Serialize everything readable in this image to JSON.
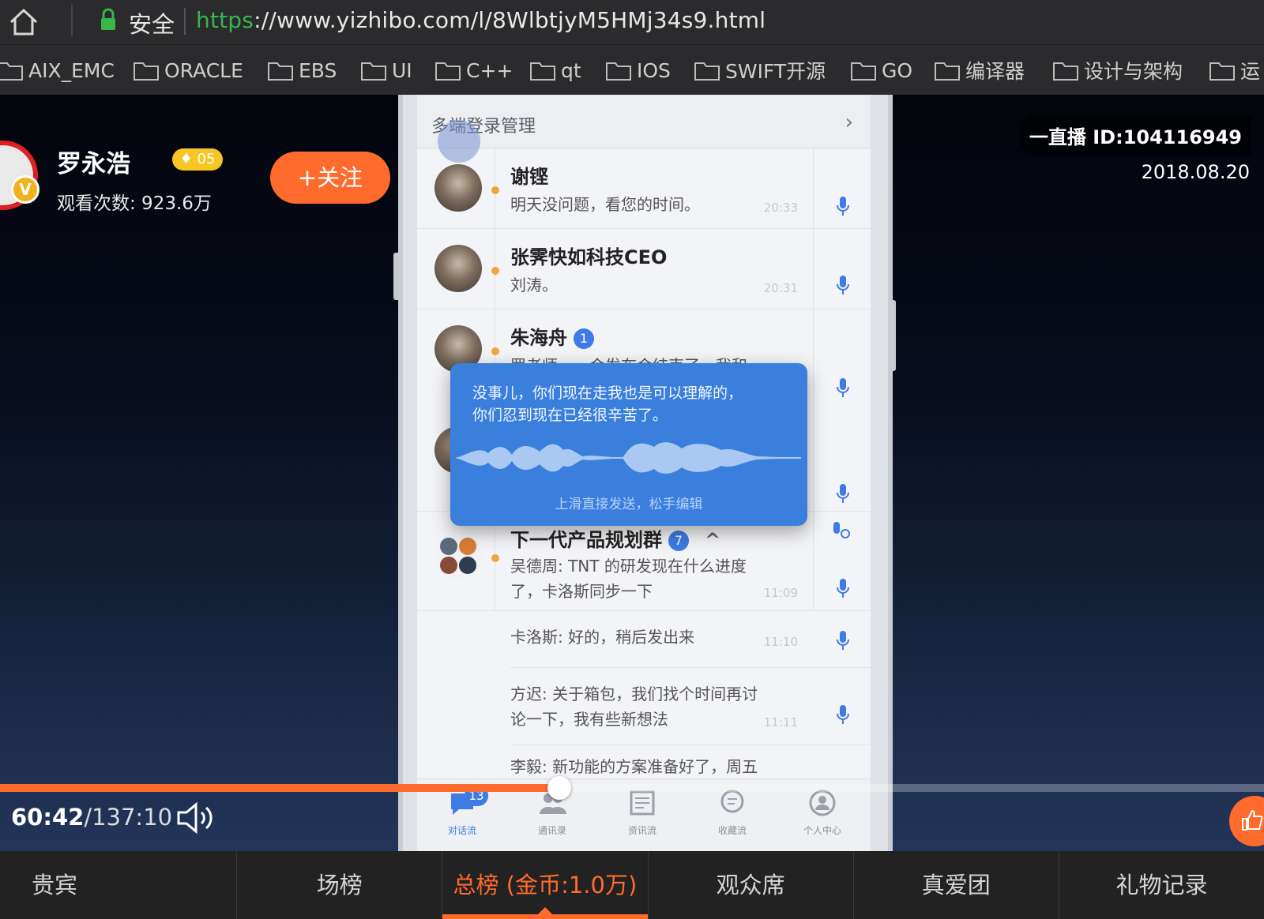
{
  "browser": {
    "secure_label": "安全",
    "url_scheme": "https",
    "url_rest": "://www.yizhibo.com/l/8WlbtjyM5HMj34s9.html",
    "bookmarks": [
      "AIX_EMC",
      "ORACLE",
      "EBS",
      "UI",
      "C++",
      "qt",
      "IOS",
      "SWIFT开源",
      "GO",
      "编译器",
      "设计与架构",
      "运"
    ]
  },
  "host": {
    "name": "罗永浩",
    "level": "05",
    "views": "观看次数: 923.6万",
    "follow_label": "+关注",
    "verified_badge": "V"
  },
  "live": {
    "id": "一直播 ID:104116949",
    "date": "2018.08.20"
  },
  "phone_screen": {
    "header_title": "多端登录管理",
    "chats": [
      {
        "name": "谢铿",
        "message": "明天没问题，看您的时间。",
        "time": "20:33"
      },
      {
        "name": "张霁快如科技CEO",
        "message": "刘涛。",
        "time": "20:31"
      },
      {
        "name": "朱海舟",
        "badge": "1",
        "message": "罗老师，一会发布会结束了，我和"
      },
      {
        "name": "下一代产品规划群",
        "badge": "7",
        "message": "吴德周: TNT 的研发现在什么进度",
        "message2": "了，卡洛斯同步一下",
        "time": "11:09"
      }
    ],
    "sub_messages": [
      {
        "message": "卡洛斯: 好的，稍后发出来",
        "time": "11:10"
      },
      {
        "message": "方迟: 关于箱包，我们找个时间再讨",
        "message2": "论一下，我有些新想法",
        "time": "11:11"
      },
      {
        "message": "李毅: 新功能的方案准备好了，周五"
      }
    ],
    "voice_popup": {
      "text": "没事儿，你们现在走我也是可以理解的，\n你们忍到现在已经很辛苦了。",
      "hint": "上滑直接发送，松手编辑"
    },
    "tabs": [
      {
        "label": "对话流",
        "count": "13"
      },
      {
        "label": "通讯录"
      },
      {
        "label": "资讯流"
      },
      {
        "label": "收藏流"
      },
      {
        "label": "个人中心"
      }
    ]
  },
  "player": {
    "current_time": "60:42",
    "total_time": "/137:10",
    "progress_fraction": 0.4427
  },
  "bottom_tabs": [
    "贵宾",
    "场榜",
    "总榜 (金币:1.0万)",
    "观众席",
    "真爱团",
    "礼物记录"
  ],
  "colors": {
    "accent": "#ff6b2c",
    "secure_green": "#39b54a",
    "chat_blue": "#3e7be6"
  }
}
